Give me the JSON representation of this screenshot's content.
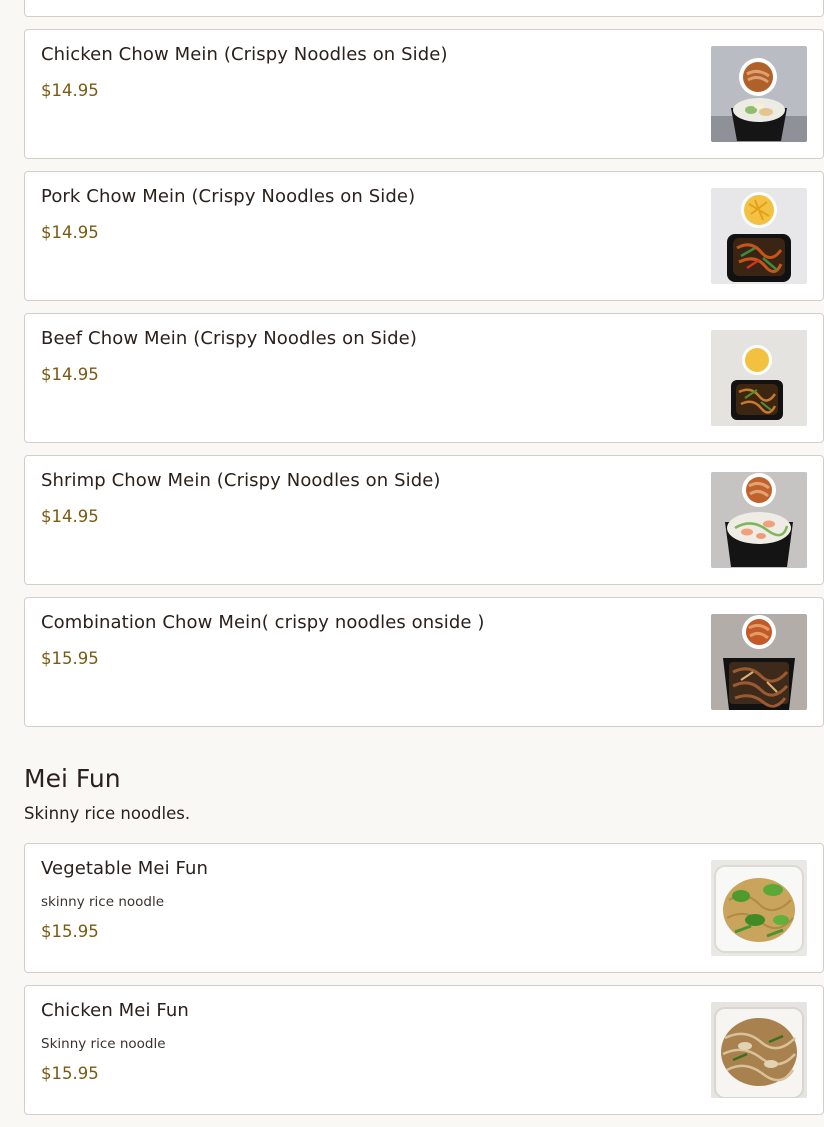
{
  "chow_mein_items": [
    {
      "name": "",
      "price": ""
    },
    {
      "name": "Chicken Chow Mein (Crispy Noodles on Side)",
      "price": "$14.95",
      "image": "chicken-chow-mein-photo"
    },
    {
      "name": "Pork Chow Mein (Crispy Noodles on Side)",
      "price": "$14.95",
      "image": "pork-chow-mein-photo"
    },
    {
      "name": "Beef Chow Mein (Crispy Noodles on Side)",
      "price": "$14.95",
      "image": "beef-chow-mein-photo"
    },
    {
      "name": "Shrimp Chow Mein (Crispy Noodles on Side)",
      "price": "$14.95",
      "image": "shrimp-chow-mein-photo"
    },
    {
      "name": "Combination Chow Mein( crispy noodles onside )",
      "price": "$15.95",
      "image": "combination-chow-mein-photo"
    }
  ],
  "mei_fun": {
    "title": "Mei Fun",
    "subtitle": "Skinny rice noodles.",
    "items": [
      {
        "name": "Vegetable Mei Fun",
        "description": "skinny rice noodle",
        "price": "$15.95",
        "image": "vegetable-mei-fun-photo"
      },
      {
        "name": "Chicken Mei Fun",
        "description": "Skinny rice noodle",
        "price": "$15.95",
        "image": "chicken-mei-fun-photo"
      }
    ]
  },
  "colors": {
    "page_background": "#faf8f5",
    "card_border": "#d4cec8",
    "price_text": "#7a5a12",
    "title_text": "#2a211c"
  }
}
